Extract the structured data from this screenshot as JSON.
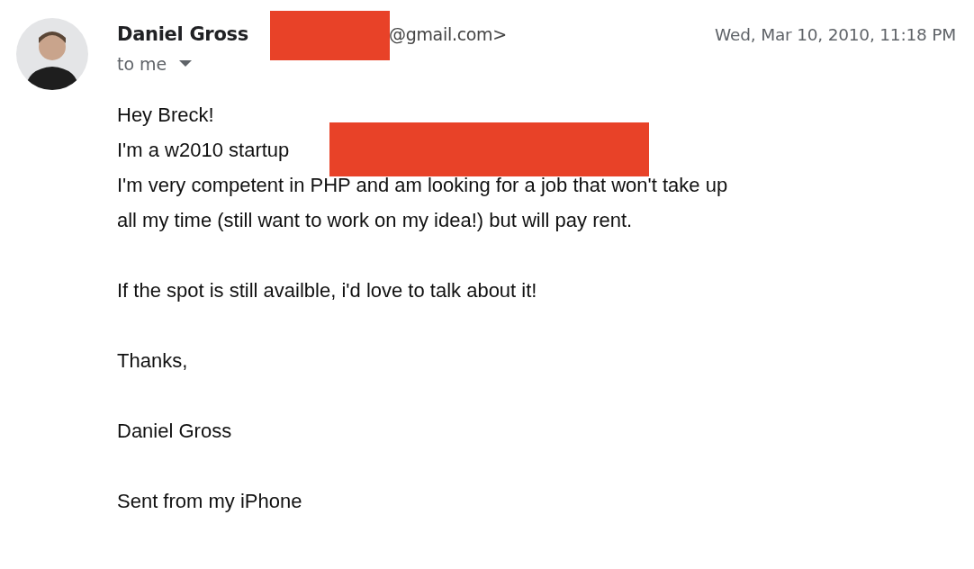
{
  "message": {
    "sender_name": "Daniel Gross",
    "sender_email_visible": "@gmail.com>",
    "date": "Wed, Mar 10, 2010, 11:18 PM",
    "recipient": "to me",
    "paragraphs": [
      {
        "kind": "text",
        "lines": [
          "Hey Breck!",
          "I'm a w2010 startup",
          "I'm very competent in PHP and am looking for a job that won't take up",
          "all my time (still want to work on my idea!) but will pay rent."
        ],
        "redacted": [
          false,
          true,
          false,
          false
        ]
      },
      {
        "kind": "text",
        "lines": [
          "If the spot is still availble, i'd love to talk about it!"
        ]
      },
      {
        "kind": "text",
        "lines": [
          "Thanks,"
        ]
      },
      {
        "kind": "text",
        "lines": [
          "Daniel Gross"
        ]
      },
      {
        "kind": "footer",
        "lines": [
          "Sent from my iPhone"
        ]
      }
    ]
  }
}
